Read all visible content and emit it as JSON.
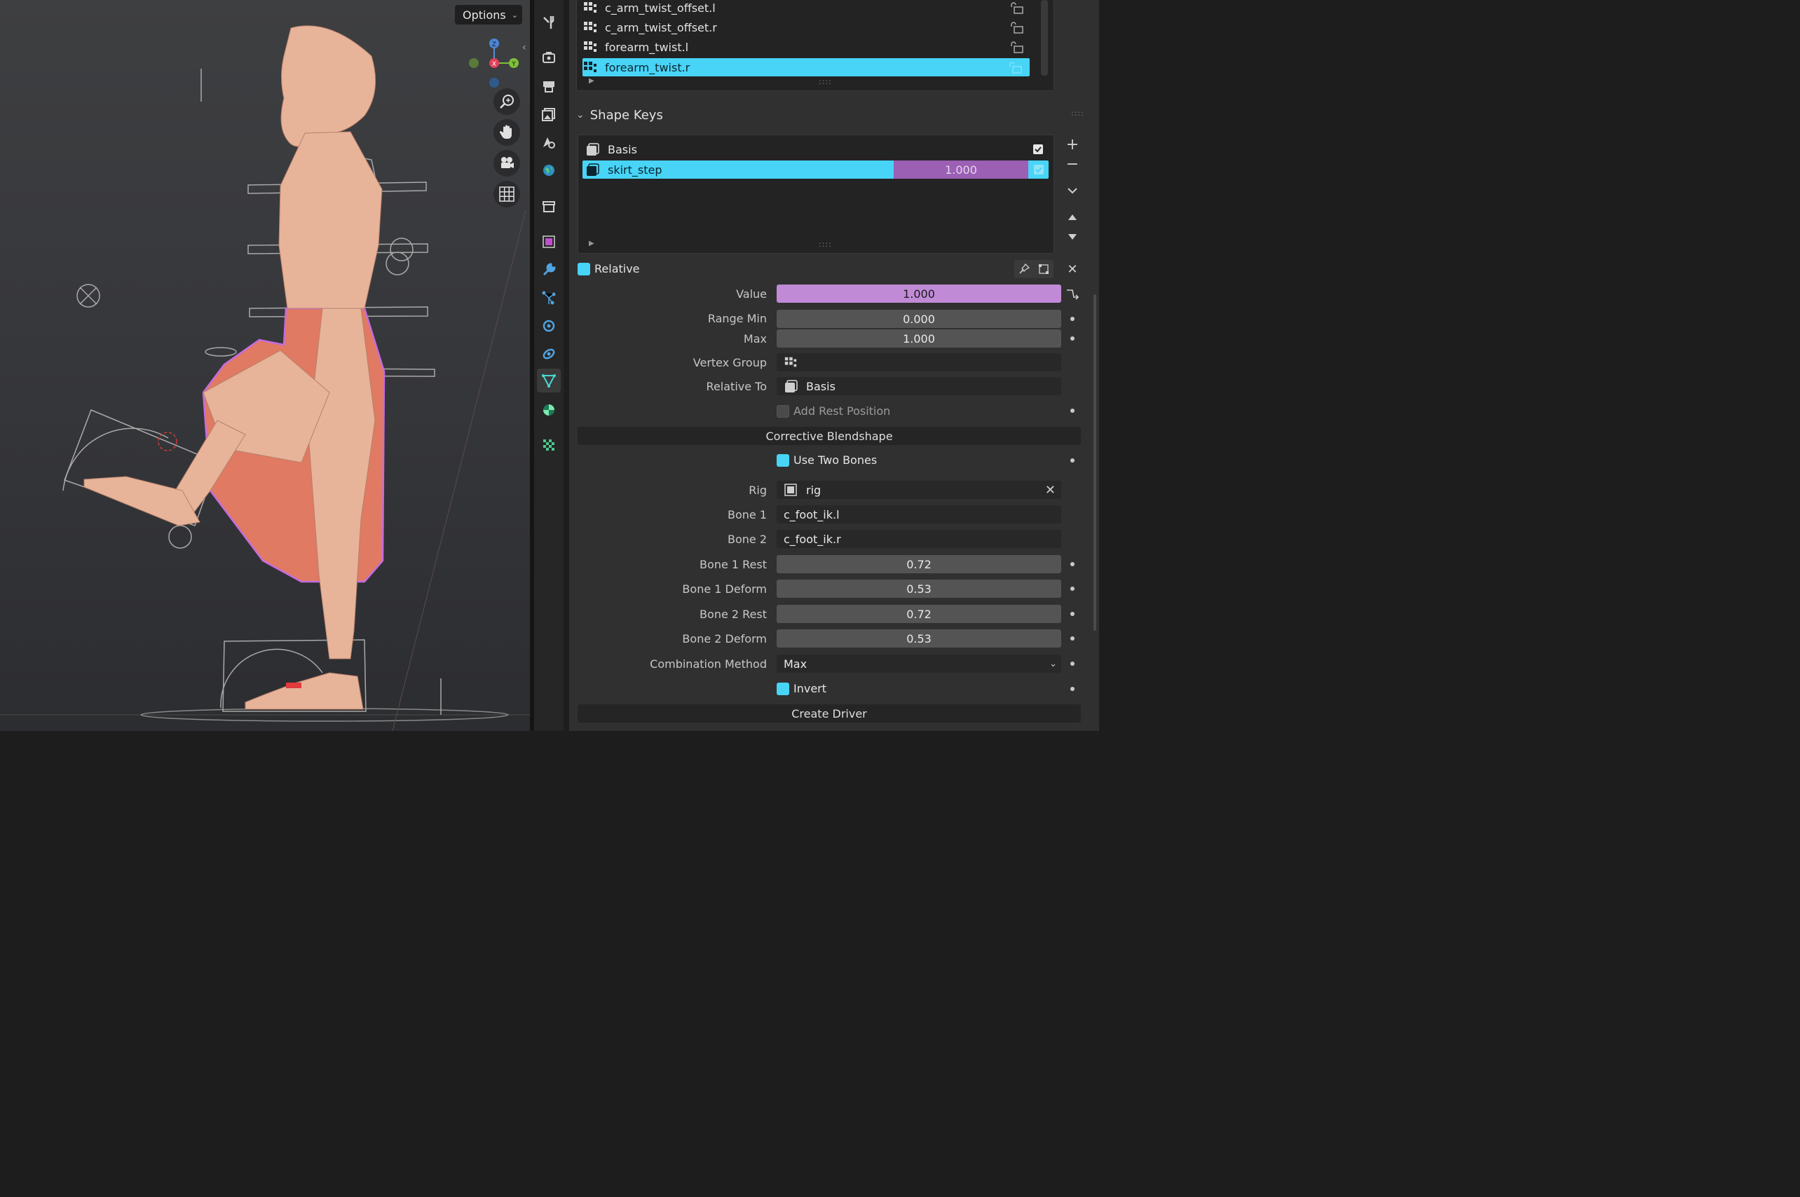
{
  "viewport": {
    "options_label": "Options",
    "gizmo": {
      "z": "Z",
      "y": "Y",
      "x": "X"
    },
    "nav_icons": [
      "zoom-icon",
      "hand-pan-icon",
      "camera-icon",
      "grid-icon"
    ]
  },
  "tabs": [
    "tool-icon",
    "render-icon",
    "output-icon",
    "view-layer-icon",
    "scene-icon",
    "world-icon",
    "collection-icon",
    "object-icon",
    "modifier-icon",
    "particles-icon",
    "physics-icon",
    "constraints-icon",
    "object-data-icon",
    "material-icon",
    "texture-icon"
  ],
  "vertex_groups": {
    "items": [
      {
        "label": "c_arm_twist_offset.l"
      },
      {
        "label": "c_arm_twist_offset.r"
      },
      {
        "label": "forearm_twist.l"
      },
      {
        "label": "forearm_twist.r",
        "selected": true
      }
    ]
  },
  "shape_keys": {
    "title": "Shape Keys",
    "items": [
      {
        "label": "Basis",
        "checked": true
      },
      {
        "label": "skirt_step",
        "value": "1.000",
        "selected": true,
        "checked": true
      }
    ],
    "relative_label": "Relative",
    "value_label": "Value",
    "value": "1.000",
    "range_min_label": "Range Min",
    "range_min": "0.000",
    "max_label": "Max",
    "max": "1.000",
    "vertex_group_label": "Vertex Group",
    "vertex_group": "",
    "relative_to_label": "Relative To",
    "relative_to": "Basis",
    "add_rest_label": "Add Rest Position"
  },
  "corrective": {
    "title": "Corrective Blendshape",
    "use_two_bones_label": "Use Two Bones",
    "rig_label": "Rig",
    "rig": "rig",
    "bone1_label": "Bone 1",
    "bone1": "c_foot_ik.l",
    "bone2_label": "Bone 2",
    "bone2": "c_foot_ik.r",
    "bone1_rest_label": "Bone 1 Rest",
    "bone1_rest": "0.72",
    "bone1_deform_label": "Bone 1 Deform",
    "bone1_deform": "0.53",
    "bone2_rest_label": "Bone 2 Rest",
    "bone2_rest": "0.72",
    "bone2_deform_label": "Bone 2 Deform",
    "bone2_deform": "0.53",
    "combination_label": "Combination Method",
    "combination": "Max",
    "invert_label": "Invert",
    "create_driver_label": "Create Driver"
  },
  "colors": {
    "accent": "#47d4f7",
    "value_purple": "#c08ad6",
    "panel": "#303030"
  }
}
